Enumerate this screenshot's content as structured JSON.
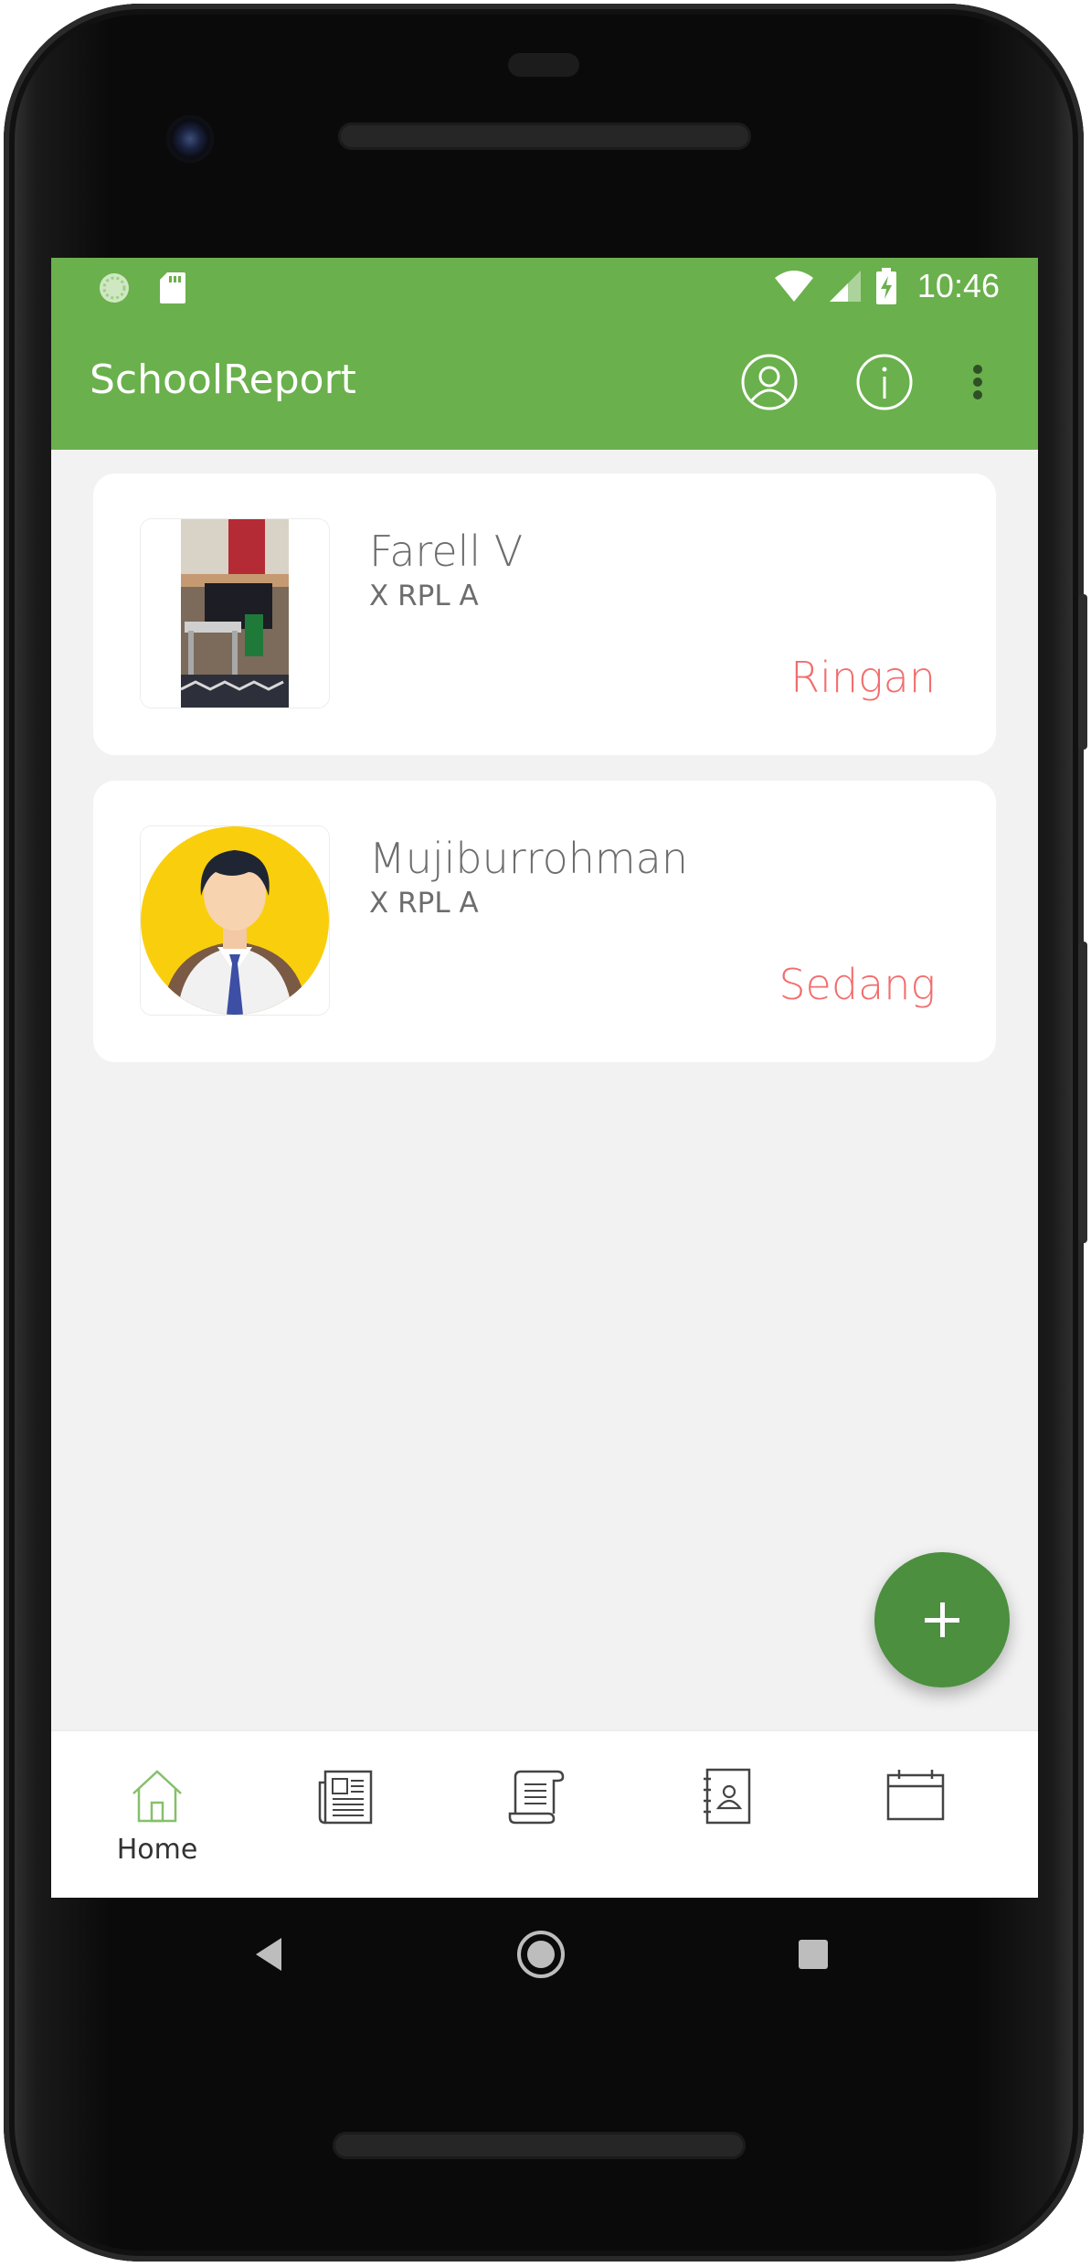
{
  "status_bar": {
    "time": "10:46"
  },
  "app_bar": {
    "title": "SchoolReport"
  },
  "reports": [
    {
      "name": "Farell V",
      "class": "X RPL A",
      "level": "Ringan",
      "avatar": "photo"
    },
    {
      "name": "Mujiburrohman",
      "class": "X RPL A",
      "level": "Sedang",
      "avatar": "student-avatar"
    }
  ],
  "bottom_nav": {
    "items": [
      {
        "icon": "home-icon",
        "label": "Home",
        "active": true
      },
      {
        "icon": "newspaper-icon",
        "label": ""
      },
      {
        "icon": "scroll-icon",
        "label": ""
      },
      {
        "icon": "contact-book-icon",
        "label": ""
      },
      {
        "icon": "calendar-icon",
        "label": ""
      }
    ]
  },
  "colors": {
    "primary": "#6ab04c",
    "fab": "#4b8f3f",
    "level_text": "#f26d6d",
    "background": "#f2f2f2"
  }
}
